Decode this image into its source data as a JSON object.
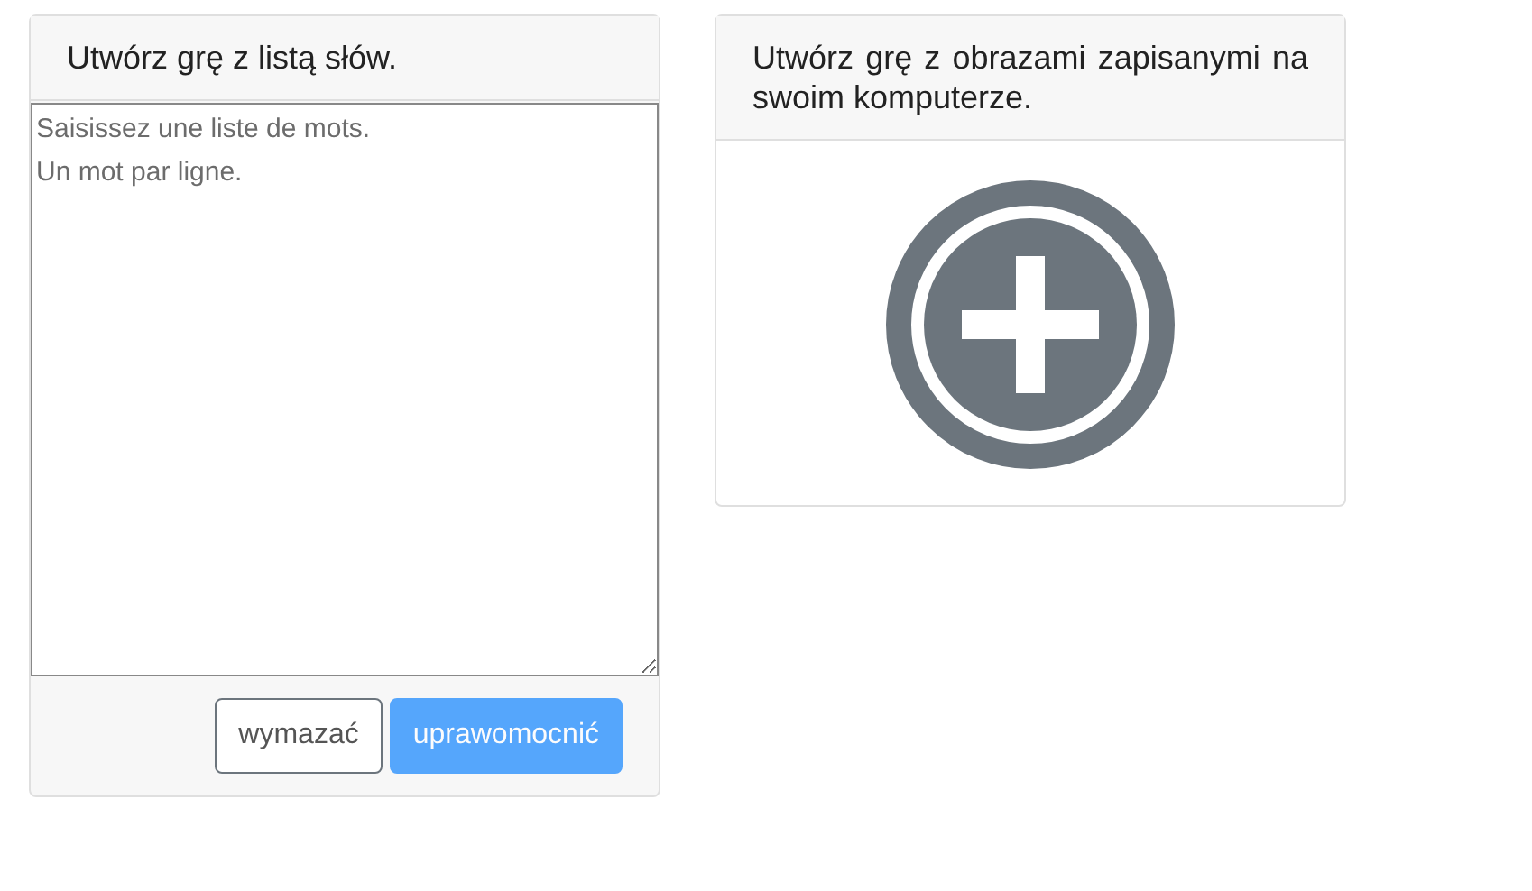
{
  "word_list_card": {
    "title": "Utwórz grę z listą słów.",
    "textarea": {
      "placeholder": "Saisissez une liste de mots.\nUn mot par ligne."
    },
    "buttons": [
      {
        "label": "wymazać",
        "kind": "outline",
        "disabled": false
      },
      {
        "label": "uprawomocnić",
        "kind": "primary",
        "disabled": true
      }
    ]
  },
  "image_card": {
    "title": "Utwórz grę z obrazami zapisanymi na swoim komputerze."
  }
}
